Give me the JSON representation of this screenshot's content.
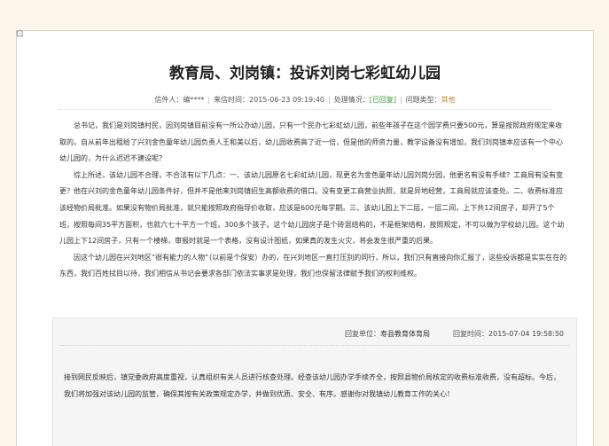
{
  "article": {
    "title": "教育局、刘岗镇：投诉刘岗七彩虹幼儿园",
    "sender_label": "信件人：",
    "sender": "编****",
    "date_label": "来信时间：",
    "date": "2015-06-23 09:19:40",
    "status_label": "处理情况：",
    "status": "[已回复]",
    "type_label": "问题类型：",
    "type": "其他",
    "paragraphs": [
      "总书记，我们是刘岗镇村民，因刘岗镇目前没有一所公办幼儿园，只有一个民办七彩虹幼儿园，前些年孩子在这个园学费只要500元，算是按照政府规定来收取的。自从前年出租给了兴刘金色童年幼儿园负责人王和美以后，幼儿园收费高了近一倍，但是他的师资力量，教学设备没有增加，我们刘岗镇本应该有一个中心幼儿园的，为什么迟迟不建设呢？",
      "综上所述，该幼儿园不合理，不合法有以下几点：一、该幼儿园原名七彩虹幼儿园，现更名为金色童年幼儿园刘岗分园，他更名有没有手续？工商局有没有变更？他在兴刘的金色童年幼儿园条件好，但并不是他来刘岗镇招生高额收费的借口。没有变更工商营业执照，就是异地经营，工商局就应该查处。二、收费标准应该经物价局批准。如果没有物价局批准，就只能按照政府指导价收取，应该是600元每学期。三、该幼儿园上下二层，一层二间，上下共12间房子，却开了5个班，按照每间35平方面积，也就六七十平方一个班，300多个孩子。这个幼儿园房子是个砖混结构的，不是框架结构，按照规定，不可以做为学校幼儿园。这个幼儿园上下12间房子，只有一个楼梯，审报时就是一个表格，没有设计图纸，如果真的发生火灾，将会发生很严重的后果。",
      "因这个幼儿园在兴刘地区“很有能力的人物”（以前是个保安）办的，在兴刘地区一直打压别的同行，所以，我们只有直接向你汇报了，这些投诉都是实实在在的东西，我们百姓拭目以待，我们相信从书记会要求各部门依法实事求是处理，我们也保留法律赋予我们的权利维权。"
    ]
  },
  "reply": {
    "unit_label": "回复单位：",
    "unit": "寿县教育体育局",
    "time_label": "回复时间：",
    "time": "2015-07-04 19:58:50",
    "text": "接到网民反映后，镇党委政府高度重视，认真组织有关人员进行核查处理。经查该幼儿园办学手续齐全，按照县物价局核定的收费标准收费，没有超标。今后，我们将加强对该幼儿园的监管，确保其按有关政策规定办学，并做到优质、安全、有序。感谢你对我镇幼儿教育工作的关心！"
  },
  "icons": {
    "corner": "document-corner-icon"
  },
  "colors": {
    "status": "#3a9c3a",
    "type": "#c8882e",
    "background": "#fbf5ea"
  }
}
